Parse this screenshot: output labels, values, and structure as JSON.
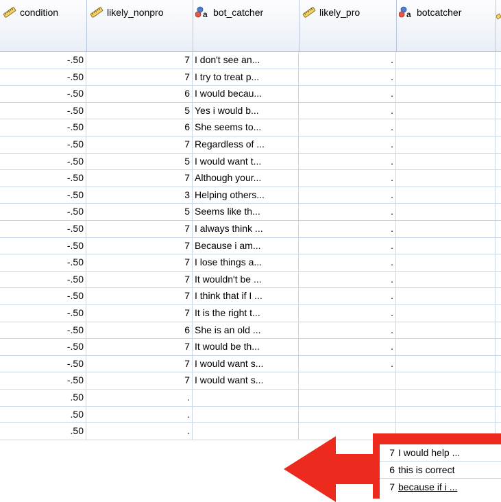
{
  "header": {
    "columns": [
      {
        "label": "condition",
        "icon": "ruler-icon"
      },
      {
        "label": "likely_nonpro",
        "icon": "ruler-icon"
      },
      {
        "label": "bot_catcher",
        "icon": "nominal-icon"
      },
      {
        "label": "likely_pro",
        "icon": "ruler-icon"
      },
      {
        "label": "botcatcher",
        "icon": "nominal-icon"
      }
    ]
  },
  "rows": [
    {
      "condition": "-.50",
      "likely_nonpro": "7",
      "bot_catcher": "I don't see an...",
      "likely_pro": ".",
      "botcatcher": ""
    },
    {
      "condition": "-.50",
      "likely_nonpro": "7",
      "bot_catcher": "I try to treat p...",
      "likely_pro": ".",
      "botcatcher": ""
    },
    {
      "condition": "-.50",
      "likely_nonpro": "6",
      "bot_catcher": "I would becau...",
      "likely_pro": ".",
      "botcatcher": ""
    },
    {
      "condition": "-.50",
      "likely_nonpro": "5",
      "bot_catcher": "Yes i would b...",
      "likely_pro": ".",
      "botcatcher": ""
    },
    {
      "condition": "-.50",
      "likely_nonpro": "6",
      "bot_catcher": "She seems to...",
      "likely_pro": ".",
      "botcatcher": ""
    },
    {
      "condition": "-.50",
      "likely_nonpro": "7",
      "bot_catcher": "Regardless of ...",
      "likely_pro": ".",
      "botcatcher": ""
    },
    {
      "condition": "-.50",
      "likely_nonpro": "5",
      "bot_catcher": "I would want t...",
      "likely_pro": ".",
      "botcatcher": ""
    },
    {
      "condition": "-.50",
      "likely_nonpro": "7",
      "bot_catcher": "Although your...",
      "likely_pro": ".",
      "botcatcher": ""
    },
    {
      "condition": "-.50",
      "likely_nonpro": "3",
      "bot_catcher": "Helping others...",
      "likely_pro": ".",
      "botcatcher": ""
    },
    {
      "condition": "-.50",
      "likely_nonpro": "5",
      "bot_catcher": "Seems like th...",
      "likely_pro": ".",
      "botcatcher": ""
    },
    {
      "condition": "-.50",
      "likely_nonpro": "7",
      "bot_catcher": "I always think ...",
      "likely_pro": ".",
      "botcatcher": ""
    },
    {
      "condition": "-.50",
      "likely_nonpro": "7",
      "bot_catcher": "Because i am...",
      "likely_pro": ".",
      "botcatcher": ""
    },
    {
      "condition": "-.50",
      "likely_nonpro": "7",
      "bot_catcher": "I lose things a...",
      "likely_pro": ".",
      "botcatcher": ""
    },
    {
      "condition": "-.50",
      "likely_nonpro": "7",
      "bot_catcher": "It wouldn't be ...",
      "likely_pro": ".",
      "botcatcher": ""
    },
    {
      "condition": "-.50",
      "likely_nonpro": "7",
      "bot_catcher": "I think that if I ...",
      "likely_pro": ".",
      "botcatcher": ""
    },
    {
      "condition": "-.50",
      "likely_nonpro": "7",
      "bot_catcher": "It is the right t...",
      "likely_pro": ".",
      "botcatcher": ""
    },
    {
      "condition": "-.50",
      "likely_nonpro": "6",
      "bot_catcher": "She is an old ...",
      "likely_pro": ".",
      "botcatcher": ""
    },
    {
      "condition": "-.50",
      "likely_nonpro": "7",
      "bot_catcher": "It would be th...",
      "likely_pro": ".",
      "botcatcher": ""
    },
    {
      "condition": "-.50",
      "likely_nonpro": "7",
      "bot_catcher": "I would want s...",
      "likely_pro": ".",
      "botcatcher": ""
    },
    {
      "condition": "-.50",
      "likely_nonpro": "7",
      "bot_catcher": "I would want s...",
      "likely_pro": "",
      "botcatcher": ""
    },
    {
      "condition": ".50",
      "likely_nonpro": ".",
      "bot_catcher": "",
      "likely_pro": "",
      "botcatcher": ""
    },
    {
      "condition": ".50",
      "likely_nonpro": ".",
      "bot_catcher": "",
      "likely_pro": "",
      "botcatcher": ""
    },
    {
      "condition": ".50",
      "likely_nonpro": ".",
      "bot_catcher": "",
      "likely_pro": "",
      "botcatcher": ""
    }
  ],
  "annotation": {
    "color": "#ec2a1e",
    "rows": [
      {
        "likely_pro": "7",
        "botcatcher": "I would help ..."
      },
      {
        "likely_pro": "6",
        "botcatcher": "this is correct"
      },
      {
        "likely_pro": "7",
        "botcatcher": "because if i ..."
      }
    ]
  },
  "colors": {
    "grid_line": "#c9d6e8",
    "header_bg": "#e9eef7"
  }
}
